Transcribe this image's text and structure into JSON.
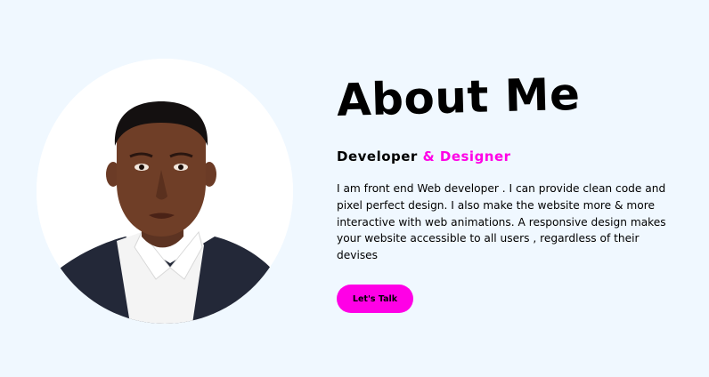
{
  "about": {
    "title": "About Me",
    "subtitle_primary": "Developer",
    "subtitle_accent": " & Designer",
    "body": "I am front end Web developer . I can provide clean code and pixel perfect design. I also make the website more & more interactive with web animations. A responsive design makes your website accessible to all users , regardless of their devises",
    "cta_label": "Let's Talk"
  },
  "colors": {
    "page_background": "#f0f8ff",
    "accent": "#ff00e6",
    "text": "#000000",
    "portrait_background": "#ffffff"
  },
  "icons": {
    "portrait": "profile-photo"
  }
}
